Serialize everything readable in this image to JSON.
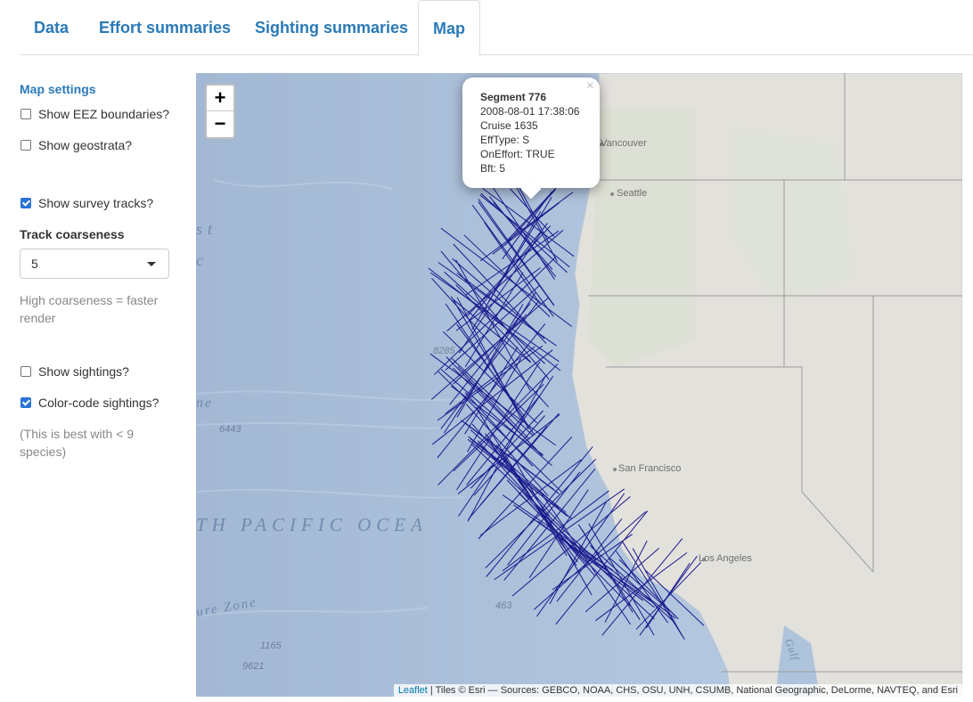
{
  "tabs": [
    {
      "label": "Data",
      "active": false
    },
    {
      "label": "Effort summaries",
      "active": false
    },
    {
      "label": "Sighting summaries",
      "active": false
    },
    {
      "label": "Map",
      "active": true
    }
  ],
  "sidebar": {
    "title": "Map settings",
    "eez": {
      "label": "Show EEZ boundaries?",
      "checked": false
    },
    "geostrata": {
      "label": "Show geostrata?",
      "checked": false
    },
    "tracks": {
      "label": "Show survey tracks?",
      "checked": true
    },
    "coarseness": {
      "label": "Track coarseness",
      "value": "5",
      "help": "High coarseness = faster render"
    },
    "sightings": {
      "label": "Show sightings?",
      "checked": false
    },
    "colorcode": {
      "label": "Color-code sightings?",
      "checked": true,
      "help": "(This is best with < 9 species)"
    }
  },
  "map": {
    "zoom_in": "+",
    "zoom_out": "−",
    "track_color": "#1a1a8c",
    "land_color": "#e3e1dc",
    "ocean_color": "#a9bfda",
    "popup": {
      "title": "Segment 776",
      "datetime": "2008-08-01 17:38:06",
      "cruise": "Cruise 1635",
      "efftype": "EffType: S",
      "oneffort": "OnEffort: TRUE",
      "bft": "Bft: 5",
      "close": "×"
    },
    "cities": [
      "Vancouver",
      "Seattle",
      "San Francisco",
      "Los Angeles"
    ],
    "ocean_label": "TH PACIFIC OCEA",
    "ocean_fragments": [
      "st",
      "c",
      "ne",
      "ure Zone",
      "Gulf"
    ],
    "depths": [
      "8285",
      "6443",
      "463",
      "1165",
      "9621"
    ],
    "attribution_link": "Leaflet",
    "attribution_text": " | Tiles © Esri — Sources: GEBCO, NOAA, CHS, OSU, UNH, CSUMB, National Geographic, DeLorme, NAVTEQ, and Esri"
  }
}
